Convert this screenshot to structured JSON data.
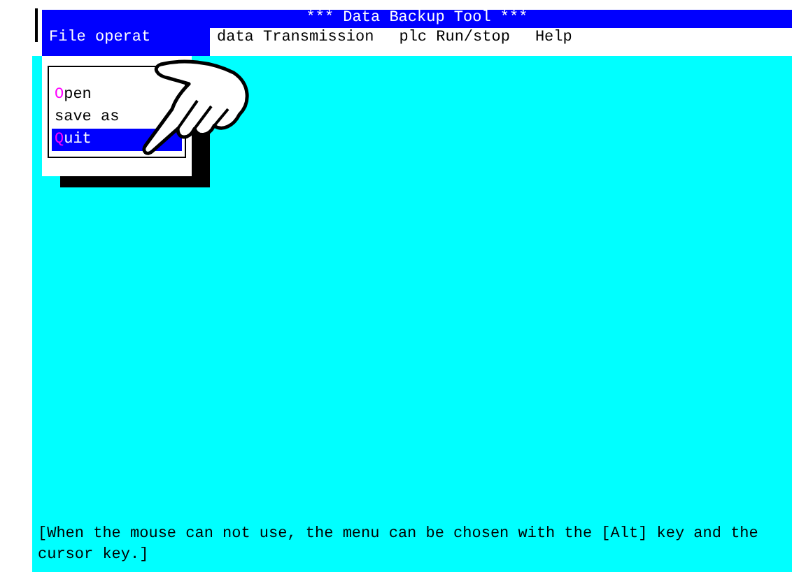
{
  "title": "***  Data Backup Tool  ***",
  "menu_bar": [
    {
      "label": "File operat",
      "selected": true
    },
    {
      "label": "data Transmission",
      "selected": false
    },
    {
      "label": "plc Run/stop",
      "selected": false
    },
    {
      "label": "Help",
      "selected": false
    }
  ],
  "dropdown": [
    {
      "hotkey": "O",
      "label": "pen",
      "selected": false
    },
    {
      "label": "save as",
      "selected": false
    },
    {
      "hotkey": "Q",
      "label": "uit",
      "selected": true
    }
  ],
  "status_text": "[When the mouse can not use, the menu can be chosen with the [Alt] key and the cursor key.]"
}
